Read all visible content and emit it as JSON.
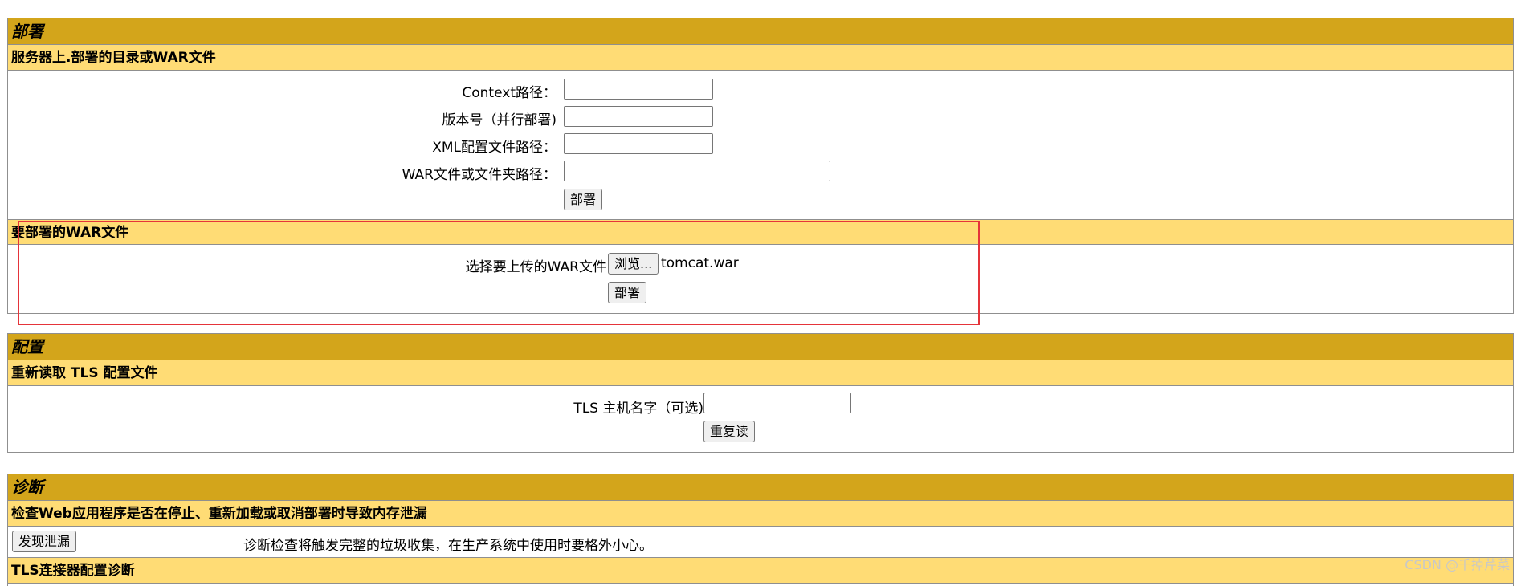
{
  "deploy": {
    "title": "部署",
    "server_subtitle": "服务器上.部署的目录或WAR文件",
    "context_label": "Context路径：",
    "context_value": "",
    "version_label": "版本号（并行部署)",
    "version_value": "",
    "xml_label": "XML配置文件路径：",
    "xml_value": "",
    "war_path_label": "WAR文件或文件夹路径：",
    "war_path_value": "",
    "deploy_button": "部署",
    "upload_subtitle": "要部署的WAR文件",
    "upload_label": "选择要上传的WAR文件",
    "browse_button": "浏览...",
    "selected_file": "tomcat.war",
    "upload_deploy_button": "部署"
  },
  "config": {
    "title": "配置",
    "tls_subtitle": "重新读取 TLS 配置文件",
    "tls_host_label": "TLS 主机名字（可选)",
    "tls_host_value": "",
    "reload_button": "重复读"
  },
  "diagnostics": {
    "title": "诊断",
    "leak_subtitle": "检查Web应用程序是否在停止、重新加载或取消部署时导致内存泄漏",
    "find_leaks_button": "发现泄漏",
    "leak_description": "诊断检查将触发完整的垃圾收集，在生产系统中使用时要格外小心。",
    "tls_diag_subtitle": "TLS连接器配置诊断"
  },
  "watermark": "CSDN @千掉芹菜",
  "colors": {
    "section_header": "#d3a51b",
    "sub_header": "#ffdc75",
    "highlight": "#e5343a"
  }
}
